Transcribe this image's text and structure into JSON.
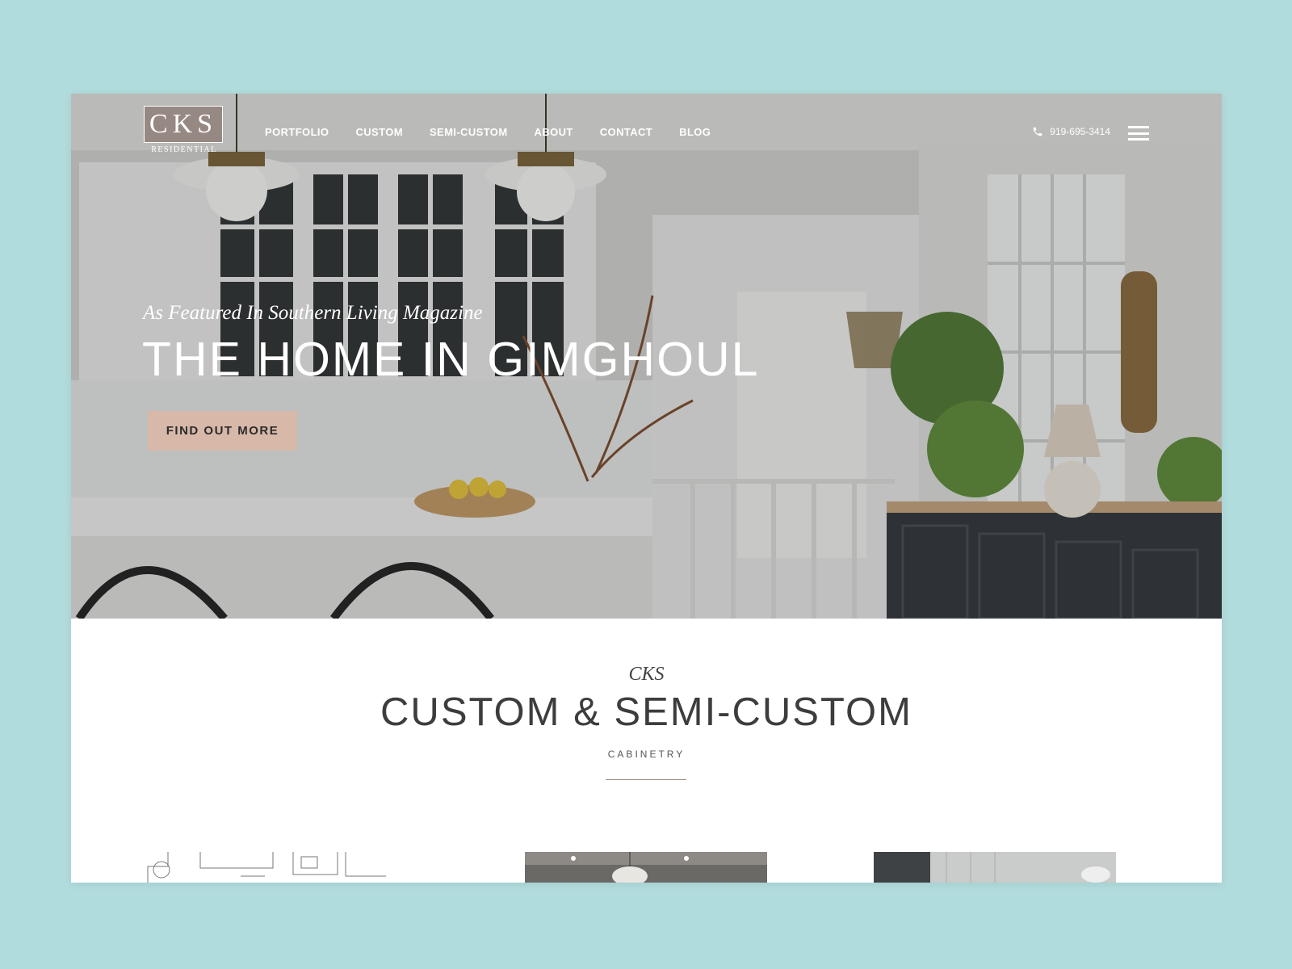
{
  "header": {
    "logo_main": "CKS",
    "logo_sub": "RESIDENTIAL",
    "nav": [
      {
        "label": "PORTFOLIO"
      },
      {
        "label": "CUSTOM"
      },
      {
        "label": "SEMI-CUSTOM"
      },
      {
        "label": "ABOUT"
      },
      {
        "label": "CONTACT"
      },
      {
        "label": "BLOG"
      }
    ],
    "phone": "919-695-3414",
    "phone_icon": "phone-icon",
    "menu_icon": "hamburger-menu-icon"
  },
  "hero": {
    "featured": "As Featured In Southern Living Magazine",
    "title": "THE HOME IN GIMGHOUL",
    "cta_label": "FIND OUT MORE",
    "cta_color": "#d8b8a9"
  },
  "section": {
    "kicker": "CKS",
    "title": "CUSTOM & SEMI-CUSTOM",
    "subtitle": "CABINETRY"
  },
  "colors": {
    "background": "#b1dcdd",
    "accent": "#d8b8a9",
    "text_dark": "#3d3d3d"
  }
}
